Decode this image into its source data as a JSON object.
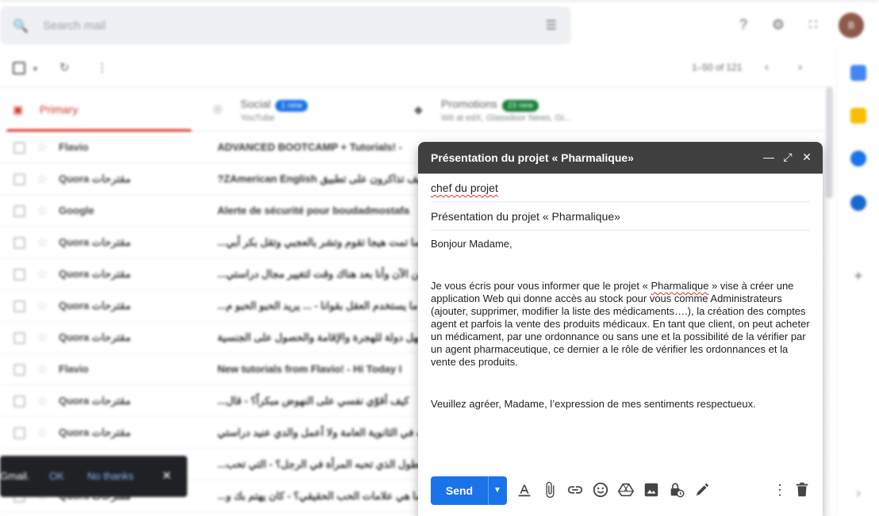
{
  "search": {
    "placeholder": "Search mail"
  },
  "account": {
    "avatar_letter": "B"
  },
  "toolbar": {
    "pagination": "1–50 of 121"
  },
  "tabs": [
    {
      "label": "Primary",
      "sub": ""
    },
    {
      "label": "Social",
      "badge": "1 new",
      "sub": "YouTube"
    },
    {
      "label": "Promotions",
      "badge": "23 new",
      "sub": "Wit at edX, Glassdoor News, Gi..."
    }
  ],
  "emails": [
    {
      "from": "Flavio",
      "subject": "ADVANCED BOOTCAMP + Tutorials! - "
    },
    {
      "from": "Quora مقترحات",
      "subject": "?ZAmerican English كيف تذاكرون على تطبيق"
    },
    {
      "from": "Google",
      "subject": "Alerte de sécurité pour boudadmostafa"
    },
    {
      "from": "Quora مقترحات",
      "subject": "...بيرا مهما تمت هيجا تقوم وتشر بالعجبي وتقل بكر أبي"
    },
    {
      "from": "Quora مقترحات",
      "subject": "...؟ هل يمكن الآن وأنا بعد هناك وقت لتغيير مجال دراستي"
    },
    {
      "from": "Quora مقترحات",
      "subject": "...ما يستخدم العقل بقوانا - ... يريد الحبو الحبو م"
    },
    {
      "from": "Quora مقترحات",
      "subject": "؟ما هو أسهل دولة للهجرة والإقامة والحصول على الجنسية"
    },
    {
      "from": "Flavio",
      "subject": "New tutorials from Flavio! - Hi Today I"
    },
    {
      "from": "Quora مقترحات",
      "subject": "...كيف أقوّي نفسي على النهوض مبكراً؟ - قال"
    },
    {
      "from": "Quora مقترحات",
      "subject": "؟أنا طالب في الثانوية العامة ولا أعمل والدي عنيد دراستي"
    },
    {
      "from": "Quora مقترحات",
      "subject": "...ما هو الطول الذي تحبه المرأة في الرجل؟ - التي تحب"
    },
    {
      "from": "Quora مقترحات",
      "subject": "...ما هي علامات الحب الحقيقي؟ - كان يهتم بك و"
    }
  ],
  "toast": {
    "text": "Gmail.",
    "ok": "OK",
    "no": "No thanks"
  },
  "compose": {
    "title": "Présentation du projet « Pharmalique»",
    "to": "chef du projet",
    "subject": "Présentation du projet « Pharmalique»",
    "greeting": "Bonjour Madame,",
    "body_pre": "Je vous écris pour vous informer que le projet « ",
    "body_word": "Pharmalique",
    "body_post": " » vise à créer une application Web qui donne accès au stock pour vous comme Administrateurs (ajouter, supprimer, modifier la liste des médicaments….), la création des comptes agent et parfois la vente des produits médicaux. En tant que client, on peut acheter un médicament, par une ordonnance ou sans une et la possibilité de la vérifier par un agent pharmaceutique, ce dernier a le rôle de vérifier les ordonnances et la vente des produits.",
    "closing": "Veuillez agréer, Madame, l’expression de mes sentiments respectueux.",
    "send_label": "Send"
  },
  "colors": {
    "send": "#1a73e8",
    "header": "#404040",
    "primary": "#d93025"
  }
}
